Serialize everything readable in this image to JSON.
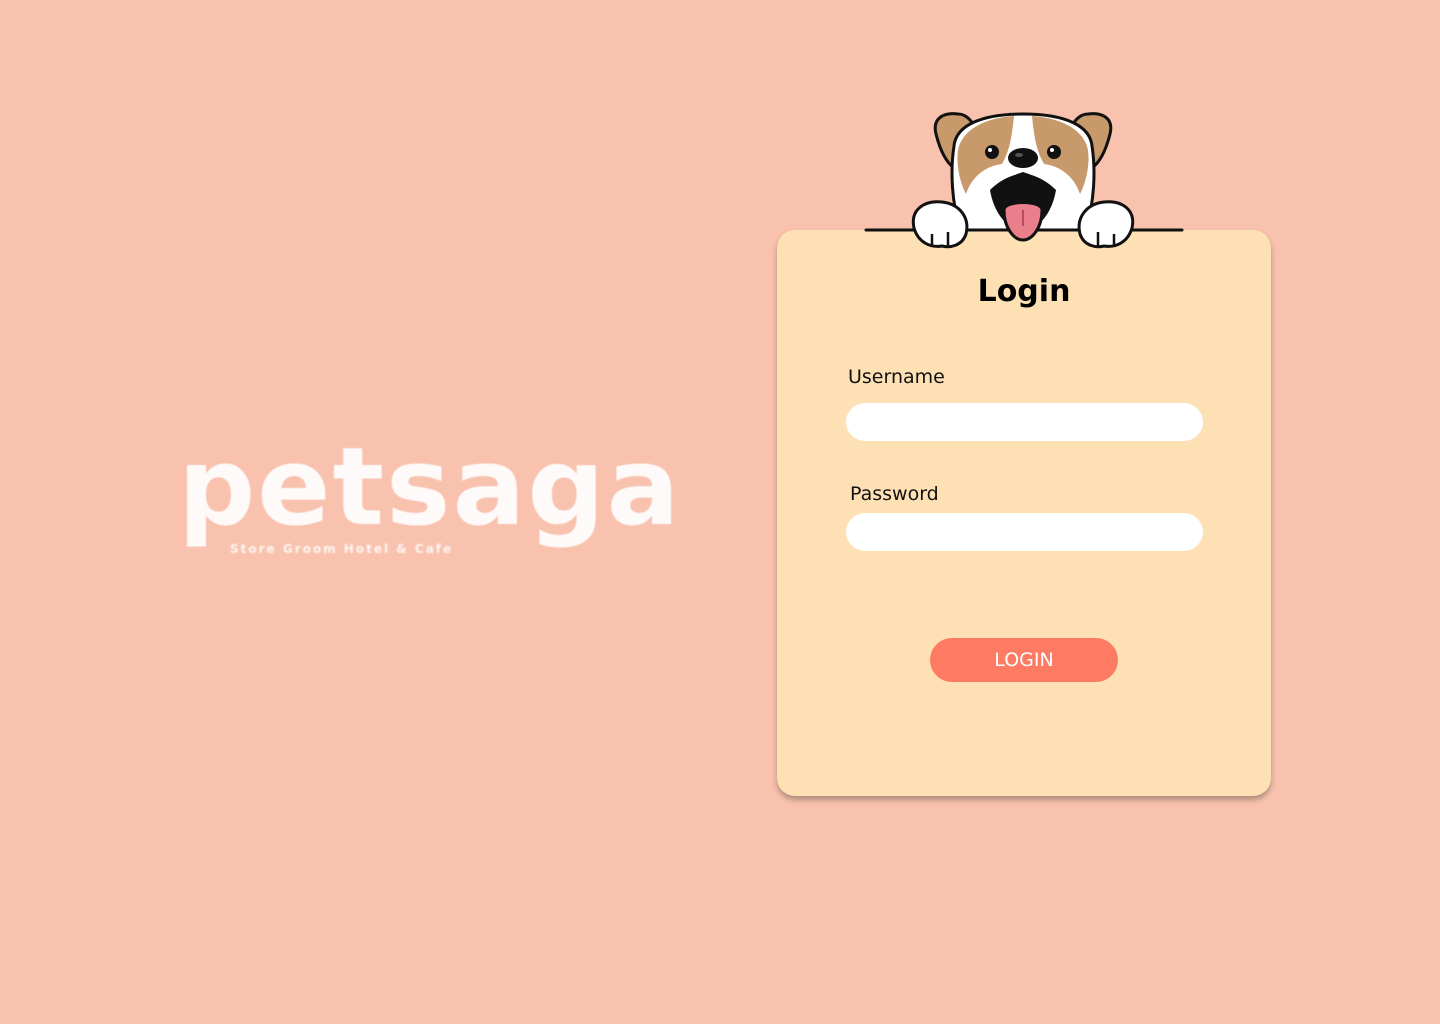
{
  "brand": {
    "wordmark": "petsaga",
    "tagline": "Store Groom Hotel & Cafe"
  },
  "mascot": {
    "icon": "dog-mascot-icon"
  },
  "login": {
    "title": "Login",
    "username_label": "Username",
    "username_value": "",
    "password_label": "Password",
    "password_value": "",
    "button_label": "LOGIN"
  },
  "colors": {
    "background": "#f8c2ae",
    "card": "#fde0b4",
    "button": "#fd7a63",
    "input": "#ffffff"
  }
}
